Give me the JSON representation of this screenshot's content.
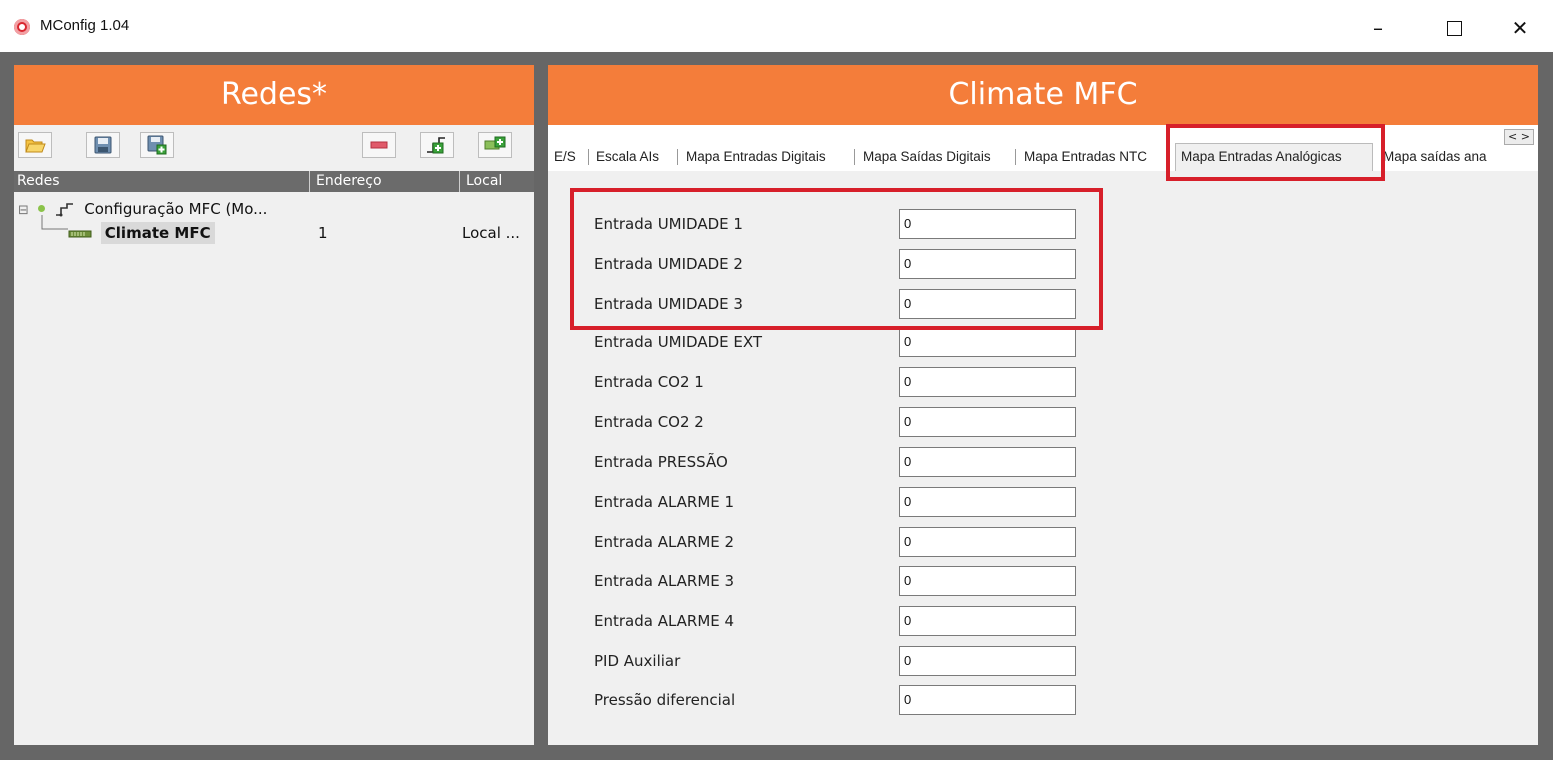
{
  "window": {
    "title": "MConfig 1.04",
    "minimize_glyph": "–",
    "close_glyph": "✕"
  },
  "left_panel": {
    "title": "Redes*",
    "toolbar": {
      "open": "folder-open-icon",
      "save": "save-icon",
      "save_as": "save-as-icon",
      "remove": "remove-icon",
      "add_network": "add-network-icon",
      "add_device": "add-device-icon"
    },
    "columns": [
      "Redes",
      "Endereço",
      "Local"
    ],
    "tree": {
      "expander": "⊟",
      "network": {
        "label": "Configuração MFC (Mo...",
        "status_color": "#8bc34a"
      },
      "device": {
        "label": "Climate MFC",
        "address": "1",
        "local": "Local ..."
      }
    }
  },
  "right_panel": {
    "title": "Climate MFC",
    "scroll_arrows": "< >",
    "tabs": [
      {
        "label": "E/S",
        "active": false
      },
      {
        "label": "Escala AIs",
        "active": false
      },
      {
        "label": "Mapa Entradas Digitais",
        "active": false
      },
      {
        "label": "Mapa Saídas Digitais",
        "active": false
      },
      {
        "label": "Mapa Entradas NTC",
        "active": false
      },
      {
        "label": "Mapa Entradas Analógicas",
        "active": true
      },
      {
        "label": "Mapa saídas ana",
        "active": false
      }
    ],
    "fields": [
      {
        "label": "Entrada UMIDADE 1",
        "value": "0"
      },
      {
        "label": "Entrada UMIDADE 2",
        "value": "0"
      },
      {
        "label": "Entrada UMIDADE 3",
        "value": "0"
      },
      {
        "label": "Entrada UMIDADE EXT",
        "value": "0"
      },
      {
        "label": "Entrada CO2 1",
        "value": "0"
      },
      {
        "label": "Entrada CO2 2",
        "value": "0"
      },
      {
        "label": "Entrada PRESSÃO",
        "value": "0"
      },
      {
        "label": "Entrada ALARME 1",
        "value": "0"
      },
      {
        "label": "Entrada ALARME 2",
        "value": "0"
      },
      {
        "label": "Entrada ALARME 3",
        "value": "0"
      },
      {
        "label": "Entrada ALARME 4",
        "value": "0"
      },
      {
        "label": "PID Auxiliar",
        "value": "0"
      },
      {
        "label": "Pressão diferencial",
        "value": "0"
      }
    ]
  },
  "colors": {
    "header_orange": "#f47d3a",
    "highlight_red": "#d71f2a",
    "frame_gray": "#666666"
  }
}
